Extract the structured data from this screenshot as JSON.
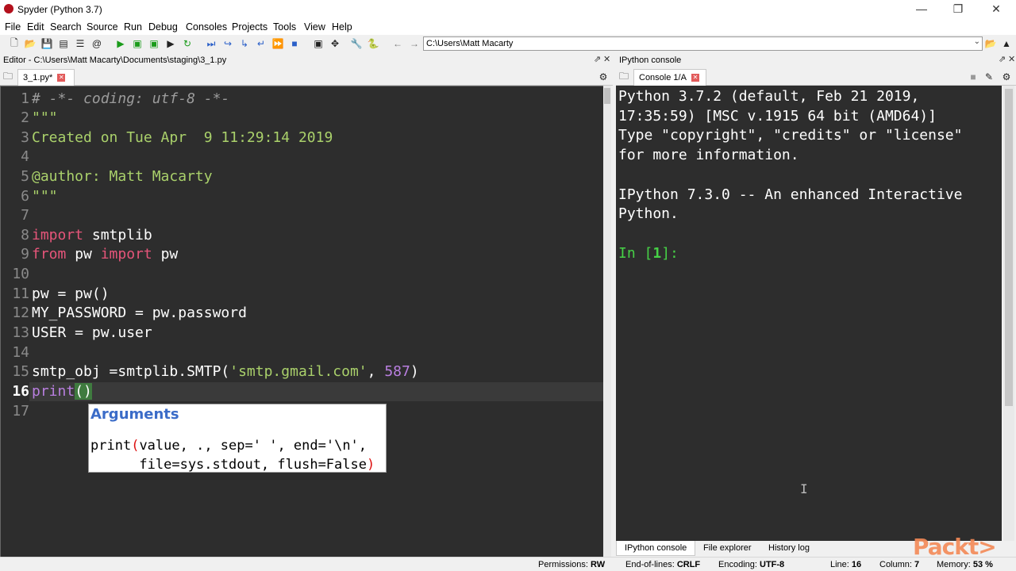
{
  "window": {
    "title": "Spyder (Python 3.7)",
    "min": "—",
    "max": "❐",
    "close": "✕"
  },
  "menu": [
    "File",
    "Edit",
    "Search",
    "Source",
    "Run",
    "Debug",
    "Consoles",
    "Projects",
    "Tools",
    "View",
    "Help"
  ],
  "toolbar": {
    "path": "C:\\Users\\Matt Macarty"
  },
  "editor": {
    "header": "Editor - C:\\Users\\Matt Macarty\\Documents\\staging\\3_1.py",
    "tab": "3_1.py*",
    "lines": [
      {
        "n": "1",
        "text": "# -*- coding: utf-8 -*-"
      },
      {
        "n": "2",
        "text": "\"\"\""
      },
      {
        "n": "3",
        "text": "Created on Tue Apr  9 11:29:14 2019"
      },
      {
        "n": "4",
        "text": ""
      },
      {
        "n": "5",
        "text": "@author: Matt Macarty"
      },
      {
        "n": "6",
        "text": "\"\"\""
      },
      {
        "n": "7",
        "text": ""
      },
      {
        "n": "8",
        "kw": "import",
        "rest": " smtplib"
      },
      {
        "n": "9",
        "kw": "from",
        "mid": " pw ",
        "kw2": "import",
        "rest": " pw"
      },
      {
        "n": "10",
        "text": ""
      },
      {
        "n": "11",
        "text": "pw = pw()"
      },
      {
        "n": "12",
        "text": "MY_PASSWORD = pw.password"
      },
      {
        "n": "13",
        "text": "USER = pw.user"
      },
      {
        "n": "14",
        "text": ""
      },
      {
        "n": "15",
        "pre": "smtp_obj =smtplib.SMTP(",
        "str": "'smtp.gmail.com'",
        "comma": ", ",
        "num": "587",
        "post": ")"
      },
      {
        "n": "16",
        "fn": "print",
        "paren": "()"
      },
      {
        "n": "17",
        "text": ""
      }
    ],
    "calltip": {
      "title": "Arguments",
      "line1_a": "print",
      "line1_b": "(",
      "line1_c": "value",
      "line1_d": ", ., sep=' ', end='\\n',",
      "line2_a": "      file=sys.stdout, flush=False",
      "line2_b": ")"
    }
  },
  "console": {
    "header": "IPython console",
    "tab": "Console 1/A",
    "lines": [
      "Python 3.7.2 (default, Feb 21 2019,",
      "17:35:59) [MSC v.1915 64 bit (AMD64)]",
      "Type \"copyright\", \"credits\" or \"license\"",
      "for more information.",
      "",
      "IPython 7.3.0 -- An enhanced Interactive",
      "Python."
    ],
    "prompt_pre": "In [",
    "prompt_num": "1",
    "prompt_post": "]:"
  },
  "bottom_tabs": [
    "IPython console",
    "File explorer",
    "History log"
  ],
  "status": {
    "permissions_label": "Permissions:",
    "permissions": "RW",
    "eol_label": "End-of-lines:",
    "eol": "CRLF",
    "encoding_label": "Encoding:",
    "encoding": "UTF-8",
    "line_label": "Line:",
    "line": "16",
    "column_label": "Column:",
    "column": "7",
    "memory_label": "Memory:",
    "memory": "53 %"
  },
  "watermark": "Packt>"
}
